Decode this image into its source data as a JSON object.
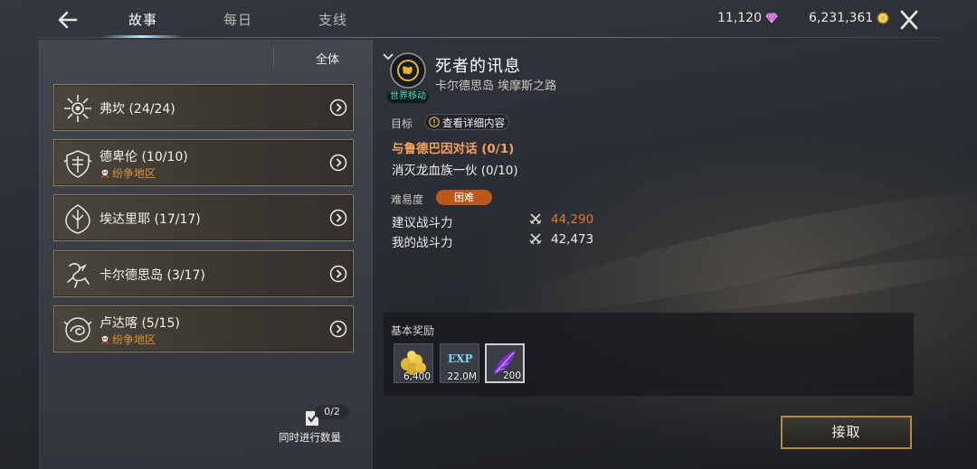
{
  "tabs": [
    {
      "label": "故事",
      "active": true
    },
    {
      "label": "每日",
      "active": false
    },
    {
      "label": "支线",
      "active": false
    }
  ],
  "currencies": [
    {
      "value": "11,120",
      "icon": "gem-icon",
      "color": "#c05ad8"
    },
    {
      "value": "6,231,361",
      "icon": "gold-coin-icon",
      "color": "#e0b63a"
    }
  ],
  "filter": {
    "label": "全体"
  },
  "regions": [
    {
      "name": "弗坎 (24/24)",
      "warzone": "",
      "icon": "sun-emblem-icon"
    },
    {
      "name": "德卑伦 (10/10)",
      "warzone": "纷争地区",
      "icon": "shield-emblem-icon"
    },
    {
      "name": "埃达里耶 (17/17)",
      "warzone": "",
      "icon": "crest-emblem-icon"
    },
    {
      "name": "卡尔德思岛 (3/17)",
      "warzone": "",
      "icon": "dragon-emblem-icon"
    },
    {
      "name": "卢达喀 (5/15)",
      "warzone": "纷争地区",
      "icon": "serpent-emblem-icon"
    }
  ],
  "concurrent": {
    "count": "0/2",
    "label": "同时进行数量"
  },
  "quest": {
    "world_tag": "世界移动",
    "title": "死者的讯息",
    "location": "卡尔德思岛 埃摩斯之路",
    "objective_label": "目标",
    "detail_button": "查看详细内容",
    "objectives": [
      "与鲁德巴因对话  (0/1)",
      "消灭龙血族一伙  (0/10)"
    ],
    "difficulty_label": "难易度",
    "difficulty": "困难",
    "recommended_label": "建议战斗力",
    "recommended_value": "44,290",
    "my_label": "我的战斗力",
    "my_value": "42,473",
    "accent_color": "#e07a2e"
  },
  "rewards": {
    "title": "基本奖励",
    "items": [
      {
        "icon": "gold-pile-icon",
        "count": "6,400"
      },
      {
        "icon": "exp-icon",
        "label": "EXP",
        "count": "22.0M"
      },
      {
        "icon": "purple-feather-icon",
        "count": "200"
      }
    ]
  },
  "accept_button": "接取"
}
